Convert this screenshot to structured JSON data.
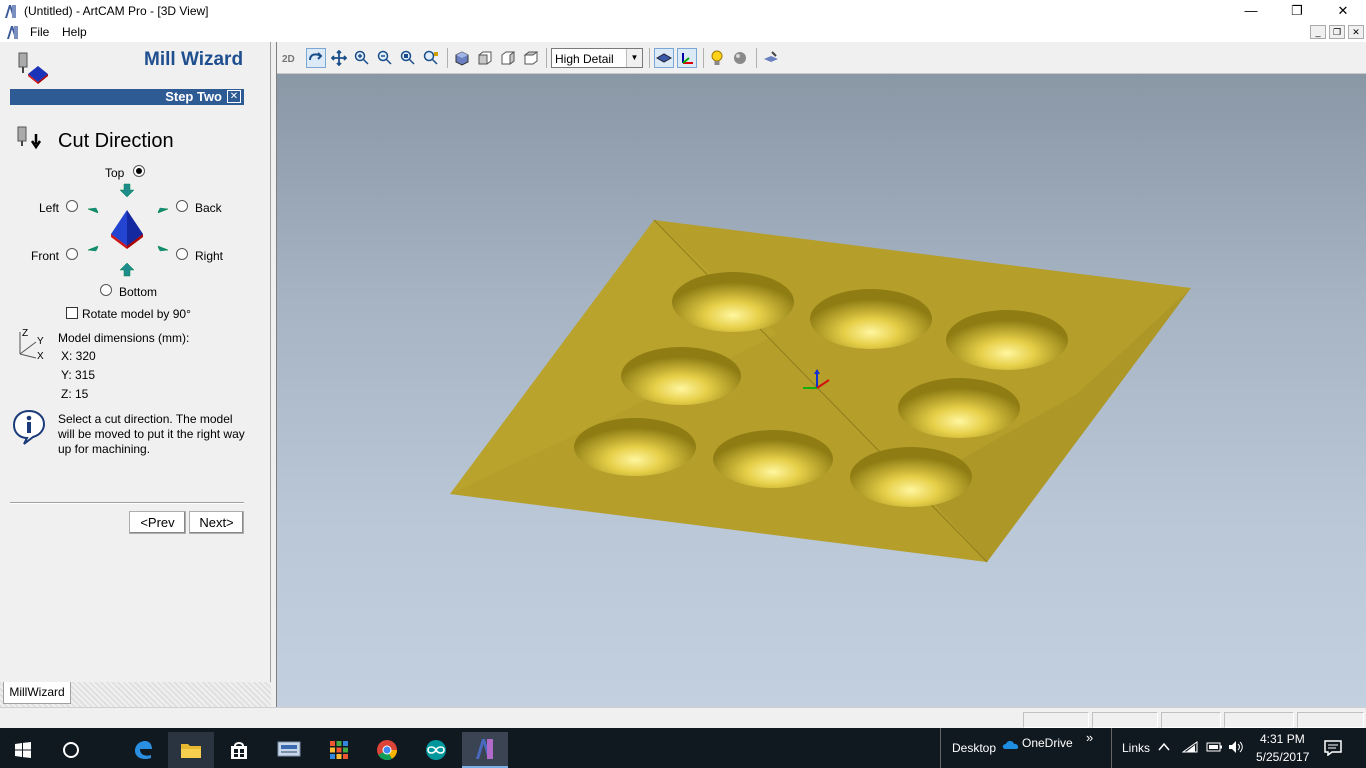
{
  "window": {
    "title": "(Untitled) - ArtCAM Pro - [3D View]",
    "minimize": "—",
    "maximize": "❐",
    "close": "✕"
  },
  "menu": {
    "file": "File",
    "help": "Help"
  },
  "wizard": {
    "title": "Mill Wizard",
    "step": "Step Two",
    "step_close": "✕",
    "heading": "Cut Direction",
    "directions": {
      "top": "Top",
      "left": "Left",
      "back": "Back",
      "front": "Front",
      "right": "Right",
      "bottom": "Bottom"
    },
    "selected_direction": "Top",
    "rotate_label": "Rotate model by 90°",
    "rotate_checked": false,
    "dims_heading": "Model dimensions (mm):",
    "dims": {
      "x": "X: 320",
      "y": "Y: 315",
      "z": "Z: 15"
    },
    "axis_labels": {
      "z": "Z",
      "y": "Y",
      "x": "X"
    },
    "info": "Select a cut direction. The model will be moved to put it the right way up for machining.",
    "prev": "<Prev",
    "next": "Next>",
    "tab": "MillWizard"
  },
  "toolbar": {
    "detail_select": "High Detail",
    "icons": [
      "2d-view-icon",
      "rotate-icon",
      "pan-icon",
      "zoom-in-icon",
      "zoom-out-icon",
      "zoom-box-icon",
      "zoom-fit-icon",
      "iso-view-icon",
      "front-view-icon",
      "side-view-icon",
      "top-view-icon",
      "shaded-icon",
      "axes-icon",
      "light-icon",
      "material-icon",
      "render-icon"
    ]
  },
  "taskbar": {
    "desktop": "Desktop",
    "onedrive": "OneDrive",
    "chevron": "»",
    "links": "Links",
    "time": "4:31 PM",
    "date": "5/25/2017"
  },
  "colors": {
    "view_top": "#8a97a5",
    "view_bottom": "#c3d0df",
    "relief": "#b9a22a",
    "wizard_bar": "#2f5b94",
    "wizard_title": "#1f4f8f"
  }
}
